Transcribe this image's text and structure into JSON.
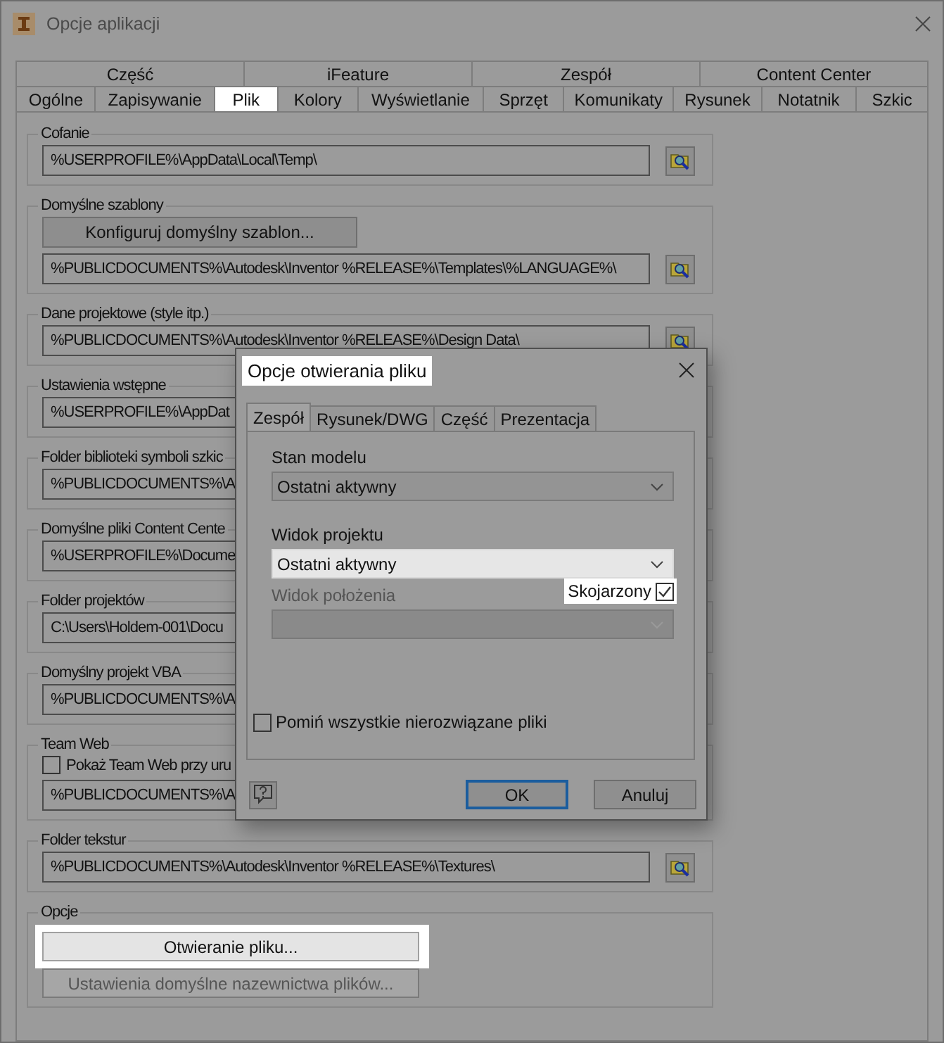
{
  "window": {
    "title": "Opcje aplikacji"
  },
  "tab_rows": [
    [
      {
        "label": "Część",
        "selected": false
      },
      {
        "label": "iFeature",
        "selected": false
      },
      {
        "label": "Zespół",
        "selected": false
      },
      {
        "label": "Content Center",
        "selected": false
      }
    ],
    [
      {
        "label": "Ogólne",
        "selected": false
      },
      {
        "label": "Zapisywanie",
        "selected": false
      },
      {
        "label": "Plik",
        "selected": true
      },
      {
        "label": "Kolory",
        "selected": false
      },
      {
        "label": "Wyświetlanie",
        "selected": false
      },
      {
        "label": "Sprzęt",
        "selected": false
      },
      {
        "label": "Komunikaty",
        "selected": false
      },
      {
        "label": "Rysunek",
        "selected": false
      },
      {
        "label": "Notatnik",
        "selected": false
      },
      {
        "label": "Szkic",
        "selected": false
      }
    ]
  ],
  "groups": [
    {
      "label": "Cofanie",
      "path": "%USERPROFILE%\\AppData\\Local\\Temp\\",
      "browse": true
    },
    {
      "label": "Domyślne szablony",
      "button": "Konfiguruj domyślny szablon...",
      "path": "%PUBLICDOCUMENTS%\\Autodesk\\Inventor %RELEASE%\\Templates\\%LANGUAGE%\\",
      "browse": true
    },
    {
      "label": "Dane projektowe (style itp.)",
      "path": "%PUBLICDOCUMENTS%\\Autodesk\\Inventor %RELEASE%\\Design Data\\",
      "browse": true
    },
    {
      "label": "Ustawienia wstępne",
      "path": "%USERPROFILE%\\AppDat",
      "browse": false
    },
    {
      "label": "Folder biblioteki symboli szkic",
      "path": "%PUBLICDOCUMENTS%\\A",
      "browse": false
    },
    {
      "label": "Domyślne pliki Content Cente",
      "path": "%USERPROFILE%\\Docume",
      "browse": false
    },
    {
      "label": "Folder projektów",
      "path": "C:\\Users\\Holdem-001\\Docu",
      "browse": false
    },
    {
      "label": "Domyślny projekt VBA",
      "path": "%PUBLICDOCUMENTS%\\A",
      "browse": false
    },
    {
      "label": "Team Web",
      "checkbox": {
        "label": "Pokaż Team Web przy uru",
        "checked": false
      },
      "path": "%PUBLICDOCUMENTS%\\A",
      "browse": false
    },
    {
      "label": "Folder tekstur",
      "path": "%PUBLICDOCUMENTS%\\Autodesk\\Inventor %RELEASE%\\Textures\\",
      "browse": true
    },
    {
      "label": "Opcje",
      "buttons": [
        {
          "label": "Otwieranie pliku...",
          "highlighted": true
        },
        {
          "label": "Ustawienia domyślne nazewnictwa plików...",
          "highlighted": false
        }
      ]
    }
  ],
  "dialog": {
    "title": "Opcje otwierania pliku",
    "title_highlighted": true,
    "tabs": [
      {
        "label": "Zespół",
        "selected": true
      },
      {
        "label": "Rysunek/DWG",
        "selected": false
      },
      {
        "label": "Część",
        "selected": false
      },
      {
        "label": "Prezentacja",
        "selected": false
      }
    ],
    "fields": [
      {
        "label": "Stan modelu",
        "value": "Ostatni aktywny",
        "disabled": false,
        "highlighted": false
      },
      {
        "label": "Widok projektu",
        "value": "Ostatni aktywny",
        "disabled": false,
        "highlighted": true
      },
      {
        "label": "Widok położenia",
        "disabled": true,
        "highlighted": false,
        "associated": {
          "label": "Skojarzony",
          "checked": true,
          "highlighted": true
        }
      }
    ],
    "skip": {
      "label": "Pomiń wszystkie nierozwiązane pliki",
      "checked": false
    },
    "buttons": [
      {
        "label": "OK",
        "default": true
      },
      {
        "label": "Anuluj",
        "default": false
      }
    ]
  }
}
